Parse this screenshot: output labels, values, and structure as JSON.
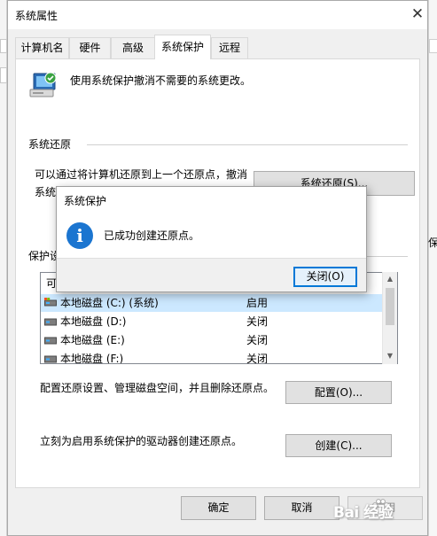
{
  "window": {
    "title": "系统属性",
    "close_glyph": "✕",
    "tabs": [
      "计算机名",
      "硬件",
      "高级",
      "系统保护",
      "远程"
    ],
    "active_tab_index": 3
  },
  "intro": {
    "text": "使用系统保护撤消不需要的系统更改。"
  },
  "restore_group": {
    "title": "系统还原",
    "line1": "可以通过将计算机还原到上一个还原点，撤消",
    "line2_fragment": "系统",
    "button_label": "系统还原(S)..."
  },
  "protection_group": {
    "title_fragment": "保护设",
    "list_header_fragment": "可",
    "drives": [
      {
        "name": "本地磁盘 (C:) (系统)",
        "status": "启用",
        "selected": true
      },
      {
        "name": "本地磁盘 (D:)",
        "status": "关闭",
        "selected": false
      },
      {
        "name": "本地磁盘 (E:)",
        "status": "关闭",
        "selected": false
      },
      {
        "name": "本地磁盘 (F:)",
        "status": "关闭",
        "selected": false
      }
    ],
    "configure_text": "配置还原设置、管理磁盘空间，并且删除还原点。",
    "configure_button": "配置(O)...",
    "create_text": "立刻为启用系统保护的驱动器创建还原点。",
    "create_button": "创建(C)..."
  },
  "footer": {
    "ok": "确定",
    "cancel": "取消",
    "apply_fragment": "应用"
  },
  "dialog": {
    "title": "系统保护",
    "message": "已成功创建还原点。",
    "close_button": "关闭(O)",
    "info_glyph": "i"
  },
  "background": {
    "right_text_fragment": "保"
  },
  "watermark": {
    "text": "Bai 经验"
  },
  "colors": {
    "accent": "#0078d7",
    "info": "#1b75d0",
    "selected_row": "#cce8ff"
  }
}
